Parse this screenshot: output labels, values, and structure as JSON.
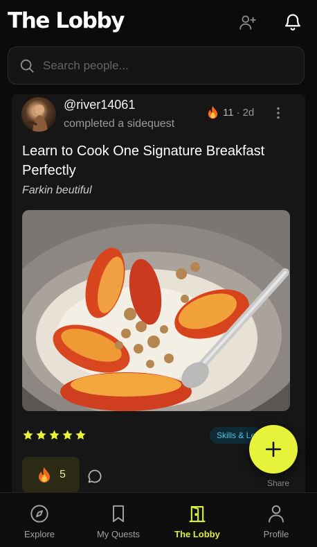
{
  "header": {
    "title": "The Lobby",
    "add_friend_icon": "user-plus-icon",
    "notifications_icon": "bell-icon"
  },
  "search": {
    "placeholder": "Search people...",
    "value": "",
    "icon": "search-icon"
  },
  "post": {
    "username": "@river14061",
    "action": "completed a sidequest",
    "fire_count": "11",
    "separator": "·",
    "time_ago": "2d",
    "quest_title": "Learn to Cook One Signature Breakfast Perfectly",
    "note": "Farkin beutiful",
    "rating": 5,
    "tag": "Skills & Le",
    "reactions": {
      "fire": "5"
    },
    "share_label": "Share"
  },
  "colors": {
    "accent": "#e6f33a",
    "tag_text": "#4fc3e8",
    "background": "#0b0b0b",
    "card": "#161616"
  },
  "nav": {
    "items": [
      {
        "label": "Explore",
        "icon": "compass-icon"
      },
      {
        "label": "My Quests",
        "icon": "bookmark-icon"
      },
      {
        "label": "The Lobby",
        "icon": "door-icon"
      },
      {
        "label": "Profile",
        "icon": "person-icon"
      }
    ],
    "active": "The Lobby"
  }
}
